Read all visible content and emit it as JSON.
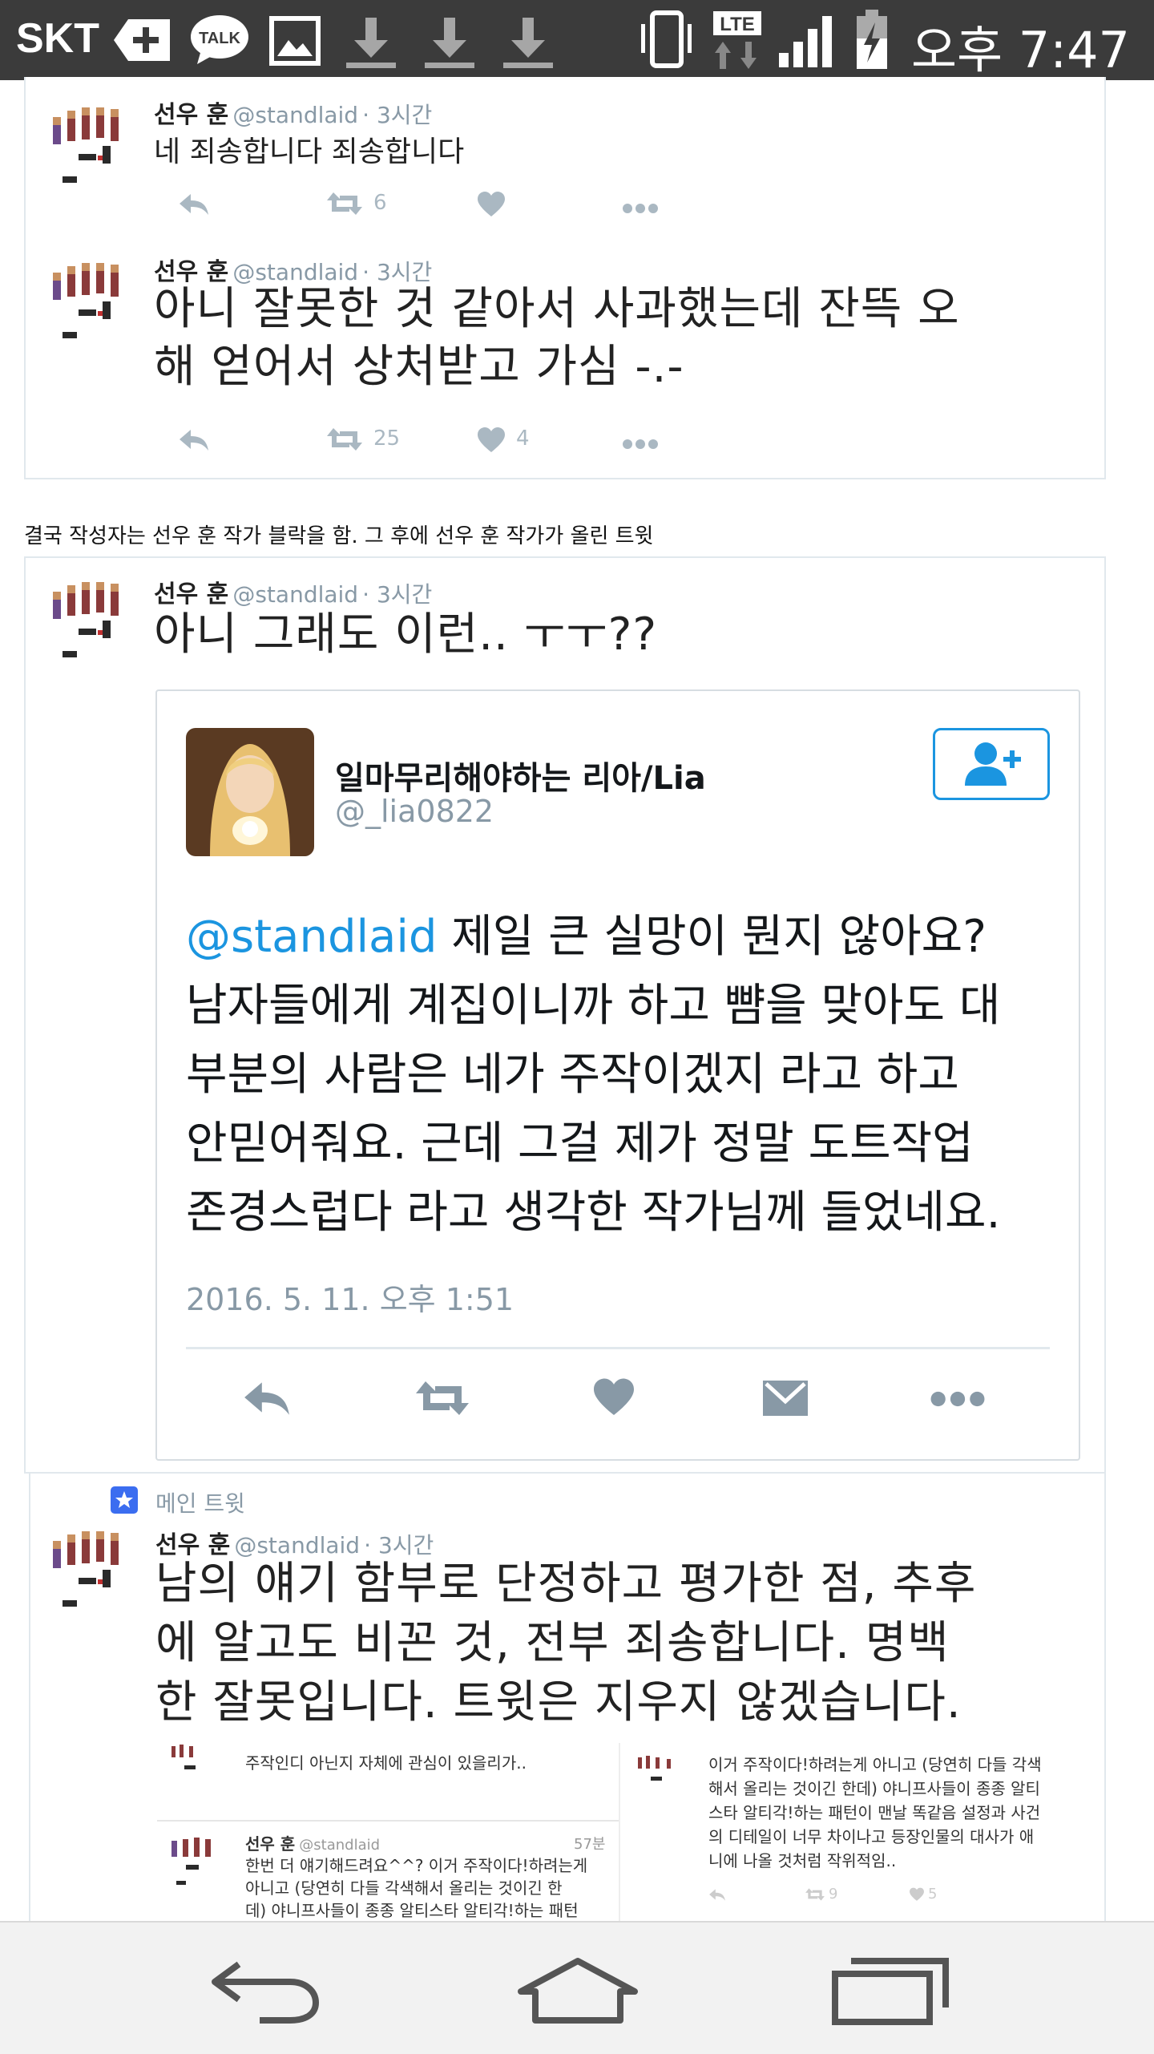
{
  "status_bar": {
    "carrier": "SKT",
    "talk_label": "TALK",
    "lte_label": "LTE",
    "time": "오후 7:47"
  },
  "tweets": [
    {
      "name": "선우 훈",
      "handle": "@standlaid",
      "time": "· 3시간",
      "text": "네 죄송합니다 죄송합니다",
      "retweets": "6",
      "likes": ""
    },
    {
      "name": "선우 훈",
      "handle": "@standlaid",
      "time": "· 3시간",
      "text_line1": "아니 잘못한 것 같아서 사과했는데 잔뜩 오",
      "text_line2": "해 얻어서 상처받고 가심 -.-",
      "retweets": "25",
      "likes": "4"
    }
  ],
  "caption": "결국 작성자는 선우 훈 작가 블락을 함. 그 후에 선우 훈 작가가 올린 트윗",
  "quote_tweet": {
    "name": "선우 훈",
    "handle": "@standlaid",
    "time": "· 3시간",
    "text": "아니 그래도 이런.. ㅜㅜ??"
  },
  "embedded_tweet": {
    "name": "일마무리해야하는 리아/Lia",
    "handle": "@_lia0822",
    "mention": "@standlaid",
    "line1": " 제일 큰 실망이 뭔지 않아요?",
    "line2": "남자들에게 계집이니까 하고 뺨을 맞아도 대",
    "line3": "부분의 사람은 네가 주작이겠지 라고 하고",
    "line4": "안믿어줘요. 근데 그걸 제가 정말 도트작업",
    "line5": "존경스럽다 라고 생각한 작가님께 들었네요.",
    "date": "2016. 5. 11. 오후 1:51"
  },
  "main_tweet": {
    "label": "메인 트윗",
    "name": "선우 훈",
    "handle": "@standlaid",
    "time": "· 3시간",
    "line1": "남의 얘기 함부로 단정하고 평가한 점, 추후",
    "line2": "에 알고도 비꼰 것, 전부 죄송합니다. 명백",
    "line3": "한 잘못입니다. 트윗은 지우지 않겠습니다."
  },
  "mini_tweets": {
    "left_top": "주작인디 아닌지 자체에 관심이 있을리가..",
    "left_name": "선우 훈",
    "left_handle": "@standlaid",
    "left_time": "57분",
    "left_line1": "한번 더 얘기해드려요^^? 이거 주작이다!하려는게",
    "left_line2": "아니고 (당연히 다들 각색해서 올리는 것이긴 한",
    "left_line3": "데) 야니프사들이 종종 알티스타 알티각!하는 패턴",
    "right_line1": "이거 주작이다!하려는게 아니고 (당연히 다들 각색",
    "right_line2": "해서 올리는 것이긴 한데) 야니프사들이 종종 알티",
    "right_line3": "스타 알티각!하는 패턴이 맨날 똑같음 설정과 사건",
    "right_line4": "의 디테일이 너무 차이나고 등장인물의 대사가 애",
    "right_line5": "니에 나올 것처럼 작위적임..",
    "right_likes": "5",
    "right_rts": "9"
  },
  "colors": {
    "status_bar": "#3b3b3b",
    "twitter_blue": "#1b95e0",
    "muted": "#aab8c2"
  }
}
